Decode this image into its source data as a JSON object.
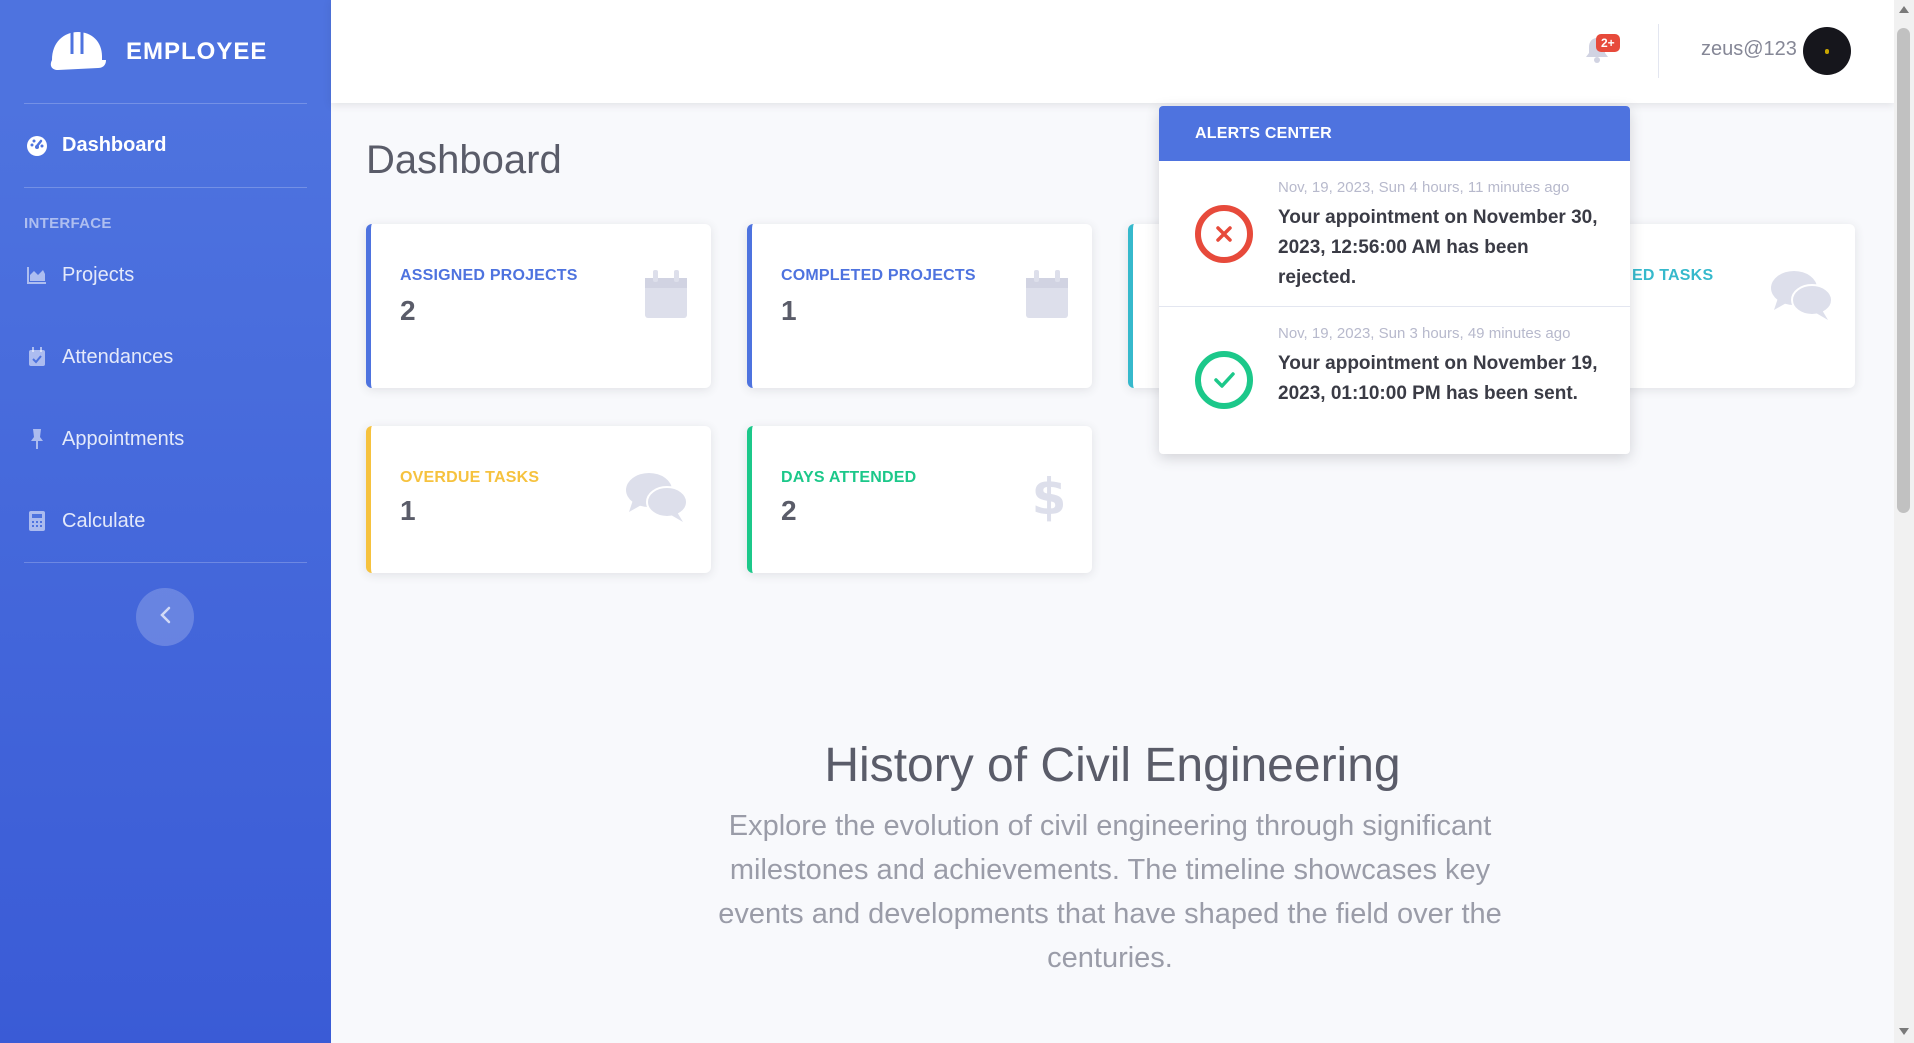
{
  "sidebar": {
    "brand": "EMPLOYEE",
    "section_heading": "INTERFACE",
    "items": [
      {
        "label": "Dashboard",
        "icon": "tachometer-icon"
      },
      {
        "label": "Projects",
        "icon": "chart-area-icon"
      },
      {
        "label": "Attendances",
        "icon": "calendar-check-icon"
      },
      {
        "label": "Appointments",
        "icon": "thumbtack-icon"
      },
      {
        "label": "Calculate",
        "icon": "calculator-icon"
      }
    ]
  },
  "topbar": {
    "notification_badge": "2+",
    "username": "zeus@123"
  },
  "page": {
    "title": "Dashboard"
  },
  "cards": [
    {
      "label": "ASSIGNED PROJECTS",
      "value": "2",
      "icon": "calendar-icon",
      "color": "#4e73df"
    },
    {
      "label": "COMPLETED PROJECTS",
      "value": "1",
      "icon": "calendar-icon",
      "color": "#4e73df"
    },
    {
      "label": "ED TASKS",
      "value": "",
      "icon": "comments-icon",
      "color": "#36b9cc"
    },
    {
      "label": "OVERDUE TASKS",
      "value": "1",
      "icon": "comments-icon",
      "color": "#f6c23e"
    },
    {
      "label": "DAYS ATTENDED",
      "value": "2",
      "icon": "dollar-icon",
      "color": "#1cc88a"
    }
  ],
  "alerts": {
    "heading": "ALERTS CENTER",
    "items": [
      {
        "date": "Nov, 19, 2023, Sun 4 hours, 11 minutes ago",
        "message": "Your appointment on November 30, 2023, 12:56:00 AM has been rejected.",
        "status": "rejected",
        "color": "#e74a3b"
      },
      {
        "date": "Nov, 19, 2023, Sun 3 hours, 49 minutes ago",
        "message": "Your appointment on November 19, 2023, 01:10:00 PM has been sent.",
        "status": "sent",
        "color": "#1cc88a"
      }
    ]
  },
  "history": {
    "title": "History of Civil Engineering",
    "description": "Explore the evolution of civil engineering through significant milestones and achievements. The timeline showcases key events and developments that have shaped the field over the centuries."
  }
}
